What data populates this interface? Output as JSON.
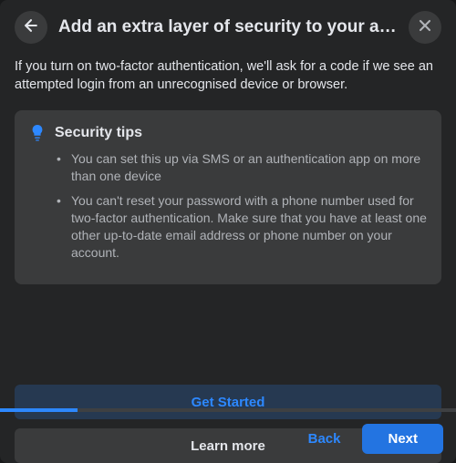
{
  "header": {
    "title": "Add an extra layer of security to your acco…"
  },
  "description": "If you turn on two-factor authentication, we'll ask for a code if we see an attempted login from an unrecognised device or browser.",
  "tips": {
    "title": "Security tips",
    "items": [
      "You can set this up via SMS or an authentication app on more than one device",
      "You can't reset your password with a phone number used for two-factor authentication. Make sure that you have at least one other up-to-date email address or phone number on your account."
    ]
  },
  "buttons": {
    "get_started": "Get Started",
    "learn_more": "Learn more",
    "back": "Back",
    "next": "Next"
  },
  "progress_percent": 17
}
